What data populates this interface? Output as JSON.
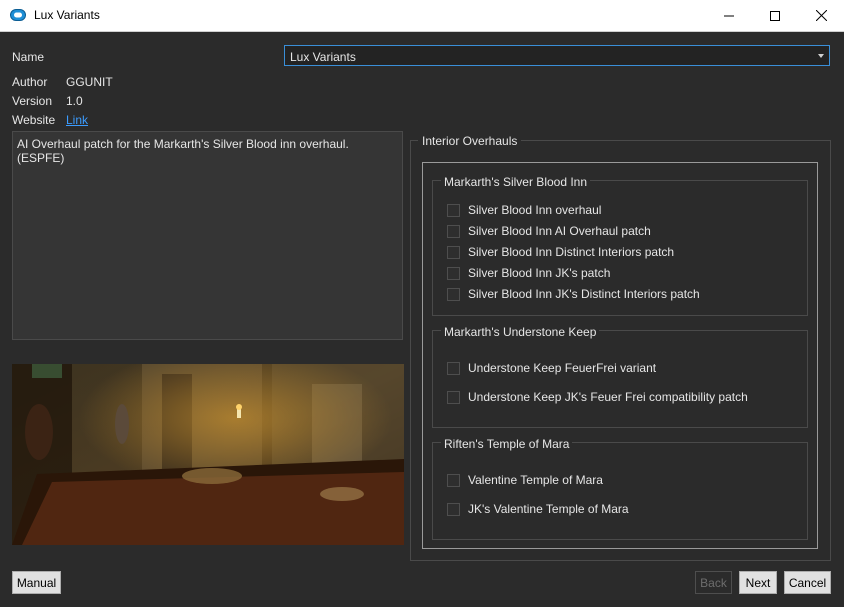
{
  "window": {
    "title": "Lux Variants",
    "minimize_icon": "minimize-icon",
    "maximize_icon": "maximize-icon",
    "close_icon": "close-icon"
  },
  "info": {
    "name_label": "Name",
    "name_value": "Lux Variants",
    "author_label": "Author",
    "author_value": "GGUNIT",
    "version_label": "Version",
    "version_value": "1.0",
    "website_label": "Website",
    "website_link": "Link"
  },
  "description": "AI Overhaul patch for the Markarth's Silver Blood inn overhaul. (ESPFE)",
  "step": {
    "title": "Interior Overhauls",
    "groups": [
      {
        "title": "Markarth's Silver Blood Inn",
        "options": [
          "Silver Blood Inn overhaul",
          "Silver Blood Inn AI Overhaul patch",
          "Silver Blood Inn Distinct Interiors patch",
          "Silver Blood Inn JK's patch",
          "Silver Blood Inn JK's Distinct Interiors patch"
        ]
      },
      {
        "title": "Markarth's Understone Keep",
        "options": [
          "Understone Keep FeuerFrei variant",
          "Understone Keep JK's Feuer Frei compatibility patch"
        ]
      },
      {
        "title": "Riften's Temple of Mara",
        "options": [
          "Valentine Temple of Mara",
          "JK's Valentine Temple of Mara"
        ]
      }
    ]
  },
  "buttons": {
    "manual": "Manual",
    "back": "Back",
    "next": "Next",
    "cancel": "Cancel"
  },
  "colors": {
    "background": "#2b2b2b",
    "accent": "#3a8fd8",
    "link": "#3b9cff"
  }
}
